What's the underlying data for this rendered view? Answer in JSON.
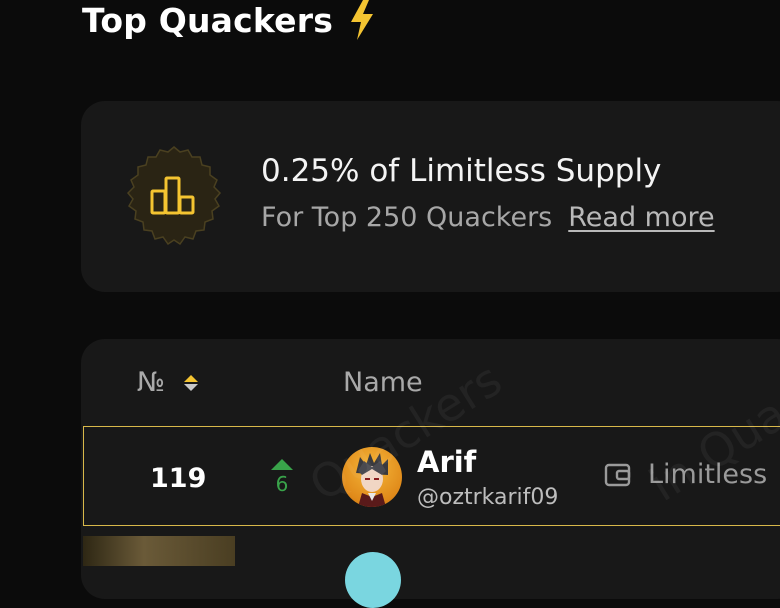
{
  "page": {
    "title": "Top Quackers"
  },
  "supply": {
    "headline": "0.25% of Limitless Supply",
    "subtext": "For Top 250 Quackers",
    "read_more": "Read more"
  },
  "table": {
    "col_rank": "№",
    "col_name": "Name",
    "highlight_row": {
      "rank": "119",
      "trend": "6",
      "name": "Arif",
      "handle": "@oztrkarif09",
      "wallet": "Limitless"
    }
  },
  "watermark": {
    "text1": "Quackers",
    "text2": "in Quack"
  },
  "colors": {
    "accent": "#f4c431",
    "trend_up": "#39a34a",
    "highlight_border": "#d8b84a",
    "background": "#0b0b0b",
    "card": "#181818"
  },
  "icons": {
    "title": "lightning-bolt-icon",
    "badge": "podium-chart-icon",
    "sort": "sort-icon",
    "trend": "arrow-up-icon",
    "wallet": "wallet-icon"
  }
}
